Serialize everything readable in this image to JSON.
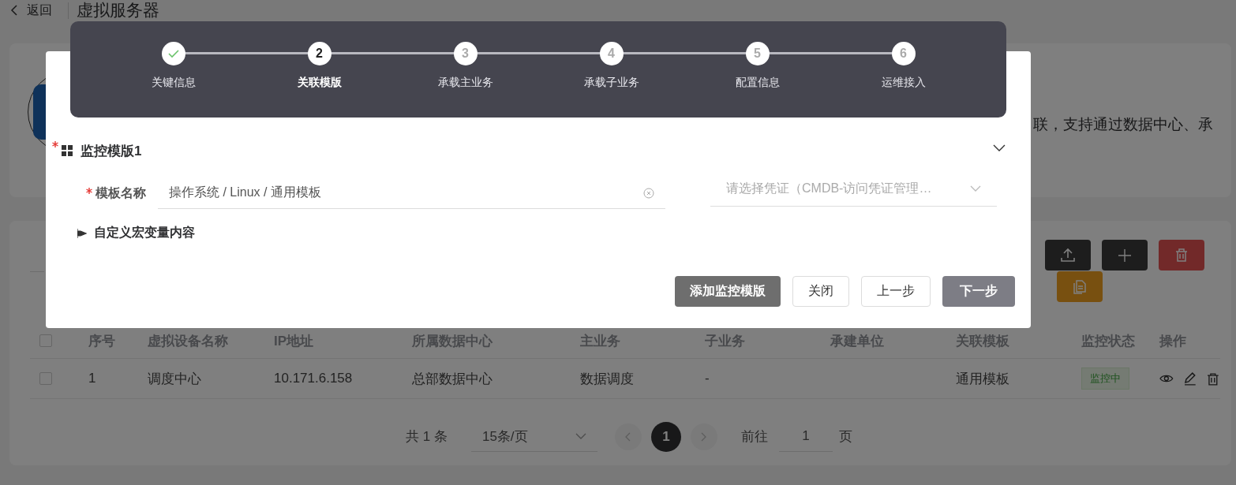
{
  "header": {
    "back": "返回",
    "title": "虚拟服务器"
  },
  "intro": {
    "text": "联，支持通过数据中心、承"
  },
  "toolbar": [
    {
      "kind": "upload"
    },
    {
      "kind": "add"
    },
    {
      "kind": "delete"
    },
    {
      "kind": "copy"
    }
  ],
  "table": {
    "select_all": {
      "checked": false
    },
    "columns": [
      "序号",
      "虚拟设备名称",
      "IP地址",
      "所属数据中心",
      "主业务",
      "子业务",
      "承建单位",
      "关联模板",
      "监控状态",
      "操作"
    ],
    "rows": [
      {
        "checked": false,
        "index": "1",
        "name": "调度中心",
        "ip": "10.171.6.158",
        "data_center": "总部数据中心",
        "main_business": "数据调度",
        "sub_business": "-",
        "template": "通用模板",
        "status": "监控中"
      }
    ]
  },
  "pagination": {
    "total": "共 1 条",
    "page_size": "15条/页",
    "pages": [
      {
        "label": "1",
        "selected": true
      }
    ],
    "goto_label": "前往",
    "goto_value": "1",
    "goto_unit": "页"
  },
  "steps": [
    {
      "label": "关键信息",
      "completed": true,
      "selected": false
    },
    {
      "number": "2",
      "label": "关联模版",
      "completed": false,
      "selected": true
    },
    {
      "number": "3",
      "label": "承载主业务",
      "completed": false,
      "selected": false
    },
    {
      "number": "4",
      "label": "承载子业务",
      "completed": false,
      "selected": false
    },
    {
      "number": "5",
      "label": "配置信息",
      "completed": false,
      "selected": false
    },
    {
      "number": "6",
      "label": "运维接入",
      "completed": false,
      "selected": false
    }
  ],
  "monitor_template": {
    "title": "监控模版1",
    "required": true,
    "expanded": true,
    "template_field": {
      "label": "模板名称",
      "required": true,
      "value": "操作系统 / Linux / 通用模板"
    },
    "credential_field": {
      "placeholder": "请选择凭证（CMDB-访问凭证管理…"
    },
    "macro_section": {
      "label": "自定义宏变量内容"
    }
  },
  "buttons": [
    {
      "label": "添加监控模版",
      "kind": "dark"
    },
    {
      "label": "关闭",
      "kind": "plain"
    },
    {
      "label": "上一步",
      "kind": "plain"
    },
    {
      "label": "下一步",
      "kind": "primary"
    }
  ]
}
